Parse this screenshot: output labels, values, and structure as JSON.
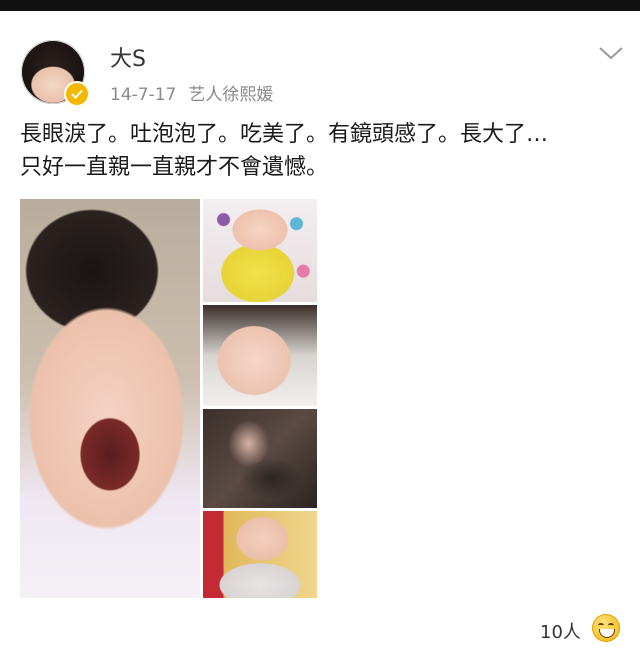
{
  "post": {
    "username": "大S",
    "date": "14-7-17",
    "source": "艺人徐熙媛",
    "text_line1": "長眼淚了。吐泡泡了。吃美了。有鏡頭感了。長大了…",
    "text_line2": "只好一直親一直親才不會遺憾。",
    "images": [
      "crying-baby-photo",
      "baby-yellow-bib-photo",
      "baby-closeup-photo",
      "baby-held-photo",
      "baby-bowtie-photo"
    ]
  },
  "footer": {
    "likes_label": "10人"
  },
  "icons": {
    "verified": "verified-badge-icon",
    "menu": "chevron-down-icon",
    "reaction": "grinning-emoji-icon"
  },
  "colors": {
    "verified_badge": "#f5b800",
    "meta_text": "#8a8a8a",
    "body_text": "#1a1a1a"
  }
}
